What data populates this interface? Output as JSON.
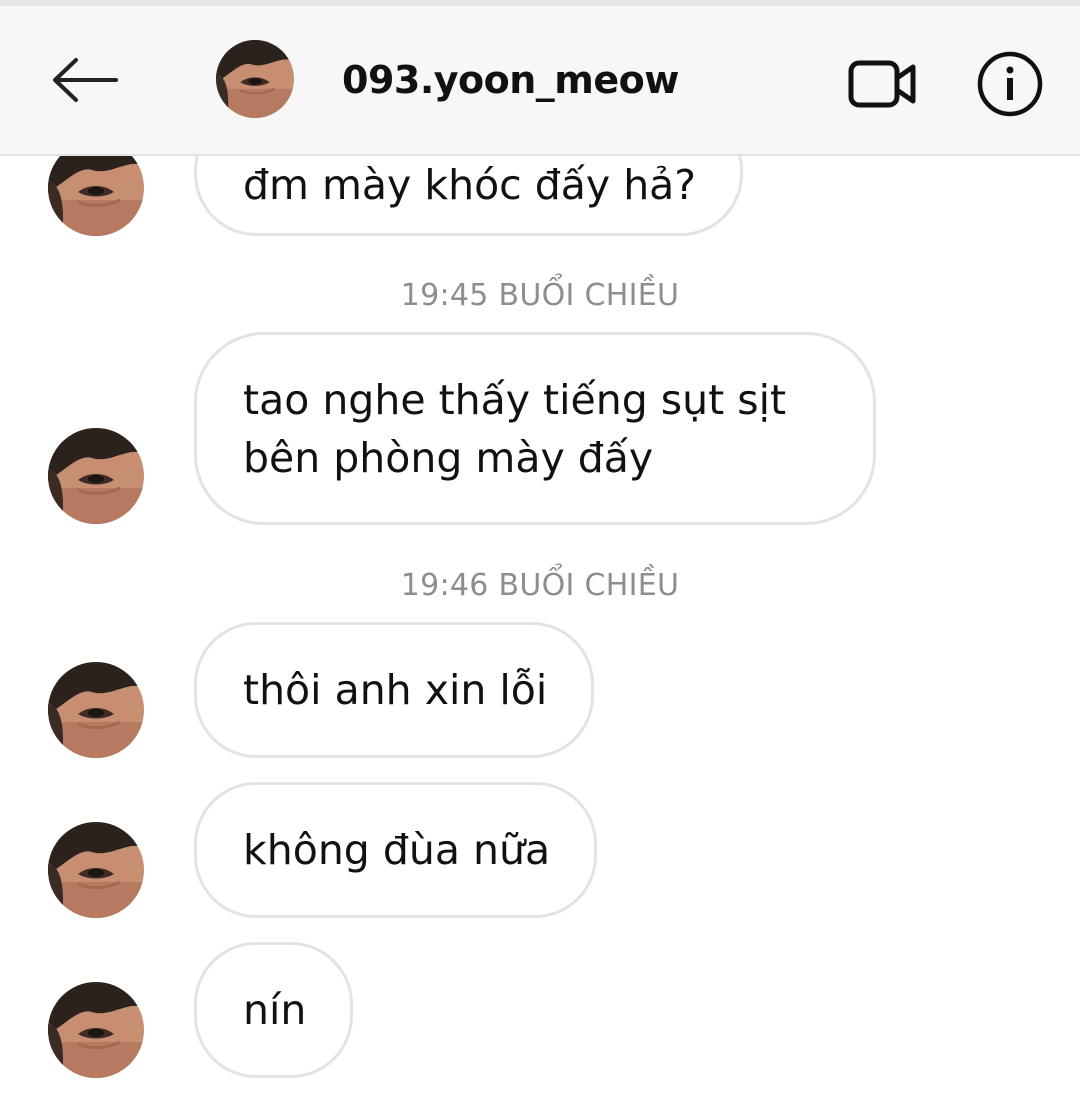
{
  "header": {
    "username": "093.yoon_meow",
    "back_icon": "arrow-left-icon",
    "video_icon": "video-camera-icon",
    "info_icon": "info-icon"
  },
  "colors": {
    "bubble_border": "#e3e3e3",
    "timestamp": "#8e8e8e",
    "header_bg": "#f7f7f7"
  },
  "messages": [
    {
      "text": "đm mày khóc đấy hả?"
    },
    {
      "timestamp": "19:45 BUỔI CHIỀU"
    },
    {
      "text": "tao nghe thấy tiếng sụt sịt bên phòng mày đấy"
    },
    {
      "timestamp": "19:46 BUỔI CHIỀU"
    },
    {
      "text": "thôi anh xin lỗi"
    },
    {
      "text": "không đùa nữa"
    },
    {
      "text": "nín"
    }
  ]
}
